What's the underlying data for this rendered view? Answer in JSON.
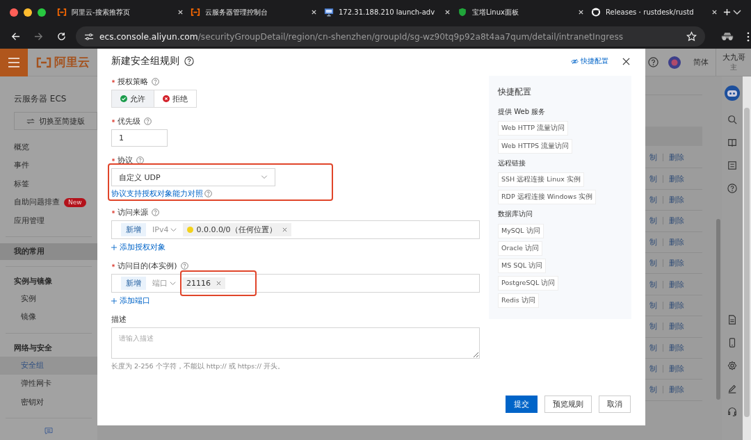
{
  "browser": {
    "tabs": [
      {
        "title": "阿里云-搜索推荐页",
        "kind": "aliyun"
      },
      {
        "title": "云服务器管理控制台",
        "kind": "aliyun"
      },
      {
        "title": "172.31.188.210 launch-adv",
        "kind": "monitor"
      },
      {
        "title": "宝塔Linux面板",
        "kind": "shield"
      },
      {
        "title": "Releases・rustdesk/rustd",
        "kind": "github"
      }
    ],
    "url": "**ecs.console.aliyun.com**/securityGroupDetail/region/cn-shenzhen/groupId/sg-wz90tq9p92a8t4aa7qum/detail/intranetIngress"
  },
  "header": {
    "logo": "阿里云",
    "language": "简体",
    "user": "大九哥",
    "user_role": "主"
  },
  "sidebar": {
    "title": "云服务器 ECS",
    "switch_button": "切换至简捷版",
    "sections": [
      {
        "items": [
          {
            "label": "概览",
            "selected": false
          },
          {
            "label": "事件",
            "selected": false
          },
          {
            "label": "标签",
            "selected": false
          },
          {
            "label": "自助问题排查",
            "badge": "New",
            "selected": false
          },
          {
            "label": "应用管理",
            "selected": false
          }
        ]
      },
      {
        "heading": "我的常用",
        "hovered": true
      },
      {
        "heading": "实例与镜像",
        "items": [
          {
            "label": "实例",
            "selected": false
          },
          {
            "label": "镜像",
            "selected": false
          }
        ]
      },
      {
        "heading": "网络与安全",
        "items": [
          {
            "label": "安全组",
            "selected": true
          },
          {
            "label": "弹性网卡",
            "selected": false
          },
          {
            "label": "密钥对",
            "selected": false
          }
        ]
      }
    ]
  },
  "background_rows": [
    {
      "actions": [
        "制",
        "删除"
      ]
    },
    {
      "actions": [
        "制",
        "删除"
      ]
    },
    {
      "actions": [
        "制",
        "删除"
      ]
    },
    {
      "actions": [
        "制",
        "删除"
      ]
    },
    {
      "actions": [
        "制",
        "删除"
      ]
    },
    {
      "actions": [
        "制",
        "删除"
      ]
    },
    {
      "actions": [
        "制",
        "删除"
      ]
    },
    {
      "actions": [
        "制",
        "删除"
      ]
    },
    {
      "actions": [
        "制",
        "删除"
      ]
    },
    {
      "actions": [
        "制",
        "删除"
      ]
    },
    {
      "actions": [
        "制",
        "删除"
      ]
    },
    {
      "actions": [
        "制",
        "删除"
      ]
    }
  ],
  "dialog": {
    "title": "新建安全组规则",
    "quick_link": "快捷配置",
    "fields": [
      {
        "kind": "segmented",
        "label": "授权策略",
        "required": true,
        "help": true,
        "options": [
          {
            "label": "允许",
            "kind": "allow",
            "selected": true
          },
          {
            "label": "拒绝",
            "kind": "deny",
            "selected": false
          }
        ]
      },
      {
        "kind": "text",
        "label": "优先级",
        "required": true,
        "help": true,
        "value": "1"
      },
      {
        "kind": "select",
        "label": "协议",
        "required": true,
        "help": true,
        "value": "自定义 UDP",
        "link": "协议支持授权对象能力对照",
        "highlighted": true
      },
      {
        "kind": "tags",
        "label": "访问来源",
        "required": true,
        "help": true,
        "prefix": "新增",
        "type": "IPv4",
        "tags": [
          {
            "text": "0.0.0.0/0（任何位置）",
            "dot": true,
            "highlighted": false
          }
        ],
        "add": "添加授权对象"
      },
      {
        "kind": "tags",
        "label": "访问目的(本实例)",
        "required": true,
        "help": true,
        "prefix": "新增",
        "type": "端口",
        "tags": [
          {
            "text": "21116",
            "dot": false,
            "highlighted": true
          }
        ],
        "add": "添加端口"
      },
      {
        "kind": "textarea",
        "label": "描述",
        "required": false,
        "help": false,
        "placeholder": "请输入描述",
        "hint": "长度为 2-256 个字符，不能以 http:// 或 https:// 开头。"
      }
    ],
    "quick_panel": {
      "title": "快捷配置",
      "groups": [
        {
          "heading": "提供 Web 服务",
          "items": [
            "Web HTTP 流量访问",
            "Web HTTPS 流量访问"
          ]
        },
        {
          "heading": "远程链接",
          "items": [
            "SSH 远程连接 Linux 实例",
            "RDP 远程连接 Windows 实例"
          ]
        },
        {
          "heading": "数据库访问",
          "items": [
            "MySQL 访问",
            "Oracle 访问",
            "MS SQL 访问",
            "PostgreSQL 访问",
            "Redis 访问"
          ]
        }
      ]
    },
    "buttons": [
      {
        "label": "提交",
        "primary": true
      },
      {
        "label": "预览规则",
        "primary": false
      },
      {
        "label": "取消",
        "primary": false
      }
    ]
  }
}
